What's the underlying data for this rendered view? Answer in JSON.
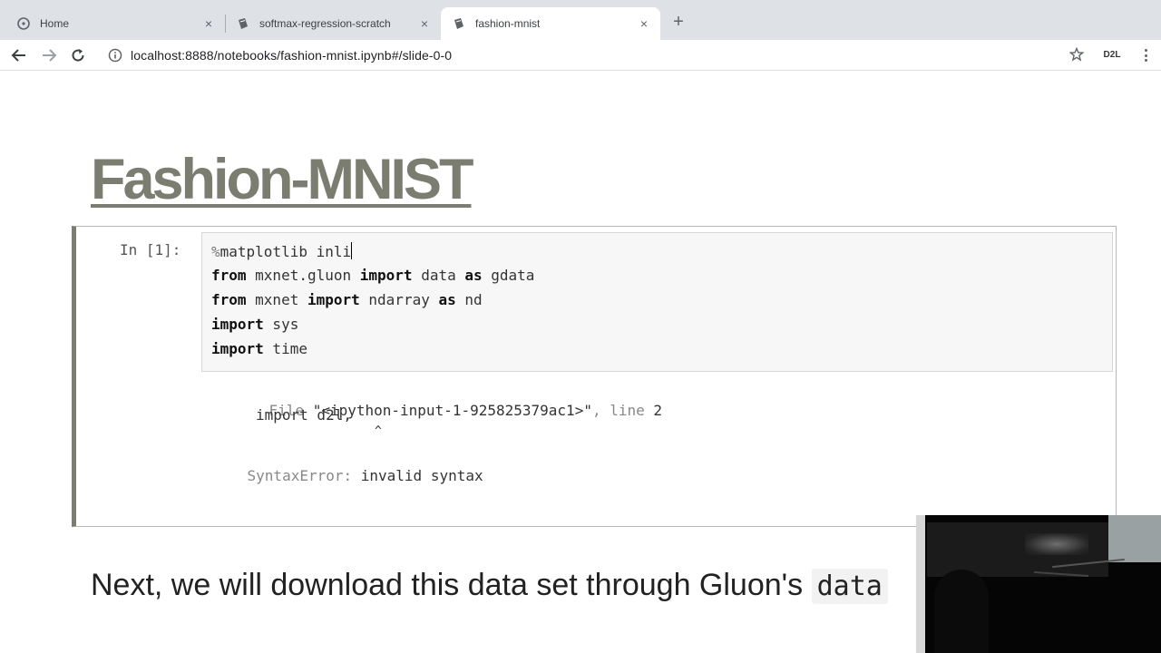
{
  "browser": {
    "tabs": [
      {
        "title": "Home",
        "active": false
      },
      {
        "title": "softmax-regression-scratch",
        "active": false
      },
      {
        "title": "fashion-mnist",
        "active": true
      }
    ],
    "close_glyph": "×",
    "new_tab_glyph": "+",
    "url": "localhost:8888/notebooks/fashion-mnist.ipynb#/slide-0-0",
    "extension_label": "D2L"
  },
  "slide": {
    "title": "Fashion-MNIST",
    "cell": {
      "prompt": "In [1]:",
      "code": [
        {
          "parts": [
            {
              "t": "%",
              "c": "magic"
            },
            {
              "t": "matplotlib inli",
              "c": ""
            }
          ]
        },
        {
          "parts": [
            {
              "t": "from",
              "c": "kw"
            },
            {
              "t": " mxnet.gluon ",
              "c": ""
            },
            {
              "t": "import",
              "c": "kw"
            },
            {
              "t": " data ",
              "c": ""
            },
            {
              "t": "as",
              "c": "kw"
            },
            {
              "t": " gdata",
              "c": ""
            }
          ]
        },
        {
          "parts": [
            {
              "t": "from",
              "c": "kw"
            },
            {
              "t": " mxnet ",
              "c": ""
            },
            {
              "t": "import",
              "c": "kw"
            },
            {
              "t": " nd",
              "c": ""
            },
            {
              "t": "array ",
              "c": ""
            },
            {
              "t": "as",
              "c": "kw"
            },
            {
              "t": " nd",
              "c": ""
            }
          ]
        },
        {
          "parts": [
            {
              "t": "import",
              "c": "kw"
            },
            {
              "t": " sys",
              "c": ""
            }
          ]
        },
        {
          "parts": [
            {
              "t": "import",
              "c": "kw"
            },
            {
              "t": " time",
              "c": ""
            }
          ]
        }
      ],
      "output": {
        "file_prefix": "File ",
        "file_name": "\"<ipython-input-1-925825379ac1>\"",
        "line_sep": ", line ",
        "line_no": "2",
        "import_line": "import d2l,",
        "caret": "^",
        "error_name": "SyntaxError:",
        "error_msg": " invalid syntax"
      }
    },
    "next_text": "Next, we will download this data set through Gluon's",
    "next_code": "data"
  },
  "colors": {
    "title": "#7b7d70",
    "cell_border_left": "#7b7d70",
    "tabstrip": "#dee1e6"
  }
}
